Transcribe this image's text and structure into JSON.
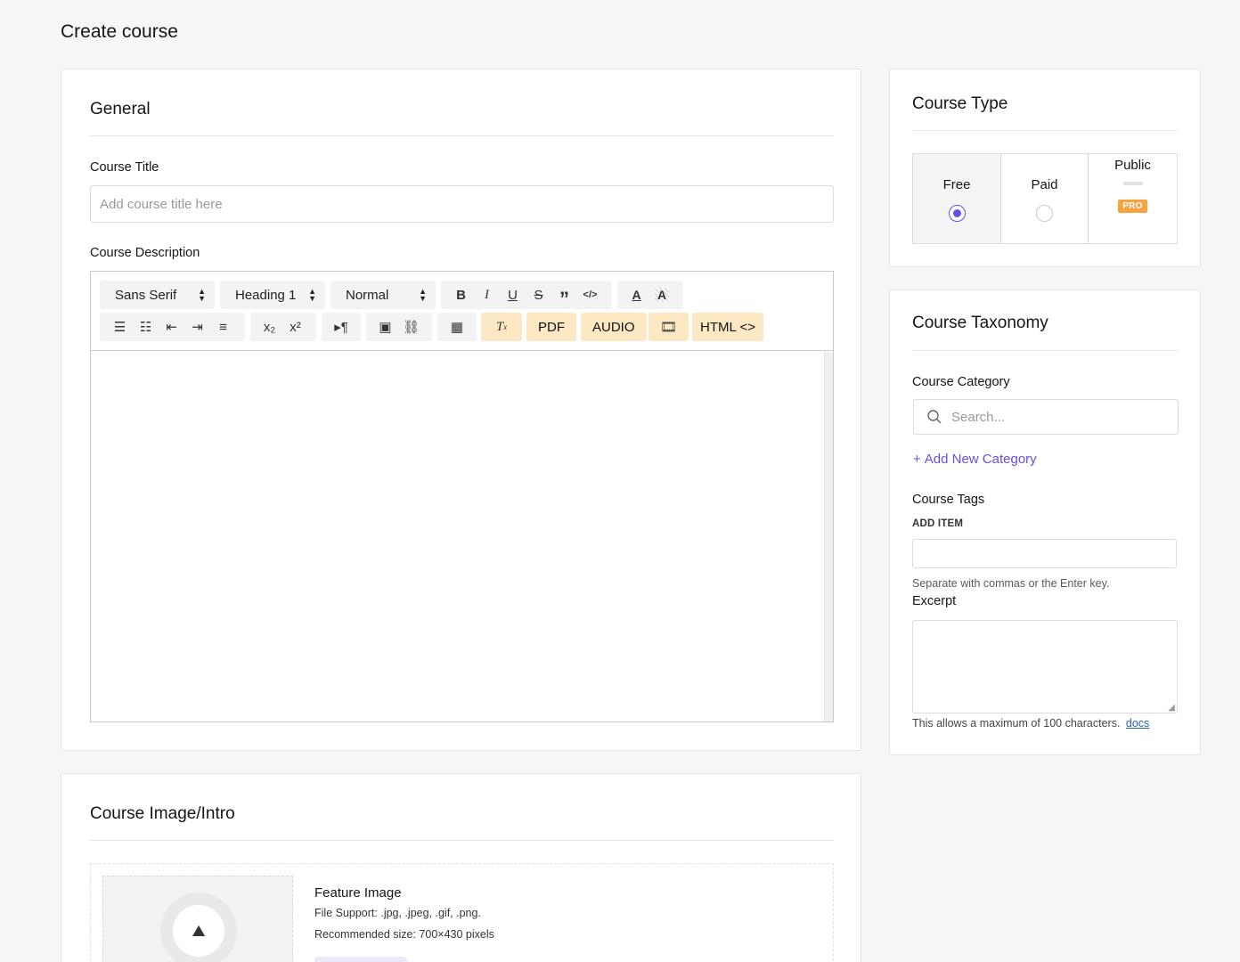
{
  "page_title": "Create course",
  "general": {
    "title": "General",
    "course_title_label": "Course Title",
    "course_title_placeholder": "Add course title here",
    "course_description_label": "Course Description",
    "toolbar": {
      "font_select": "Sans Serif",
      "heading_select": "Heading 1",
      "size_select": "Normal",
      "pdf": "PDF",
      "audio": "AUDIO",
      "html": "HTML <>"
    }
  },
  "course_type": {
    "title": "Course Type",
    "options": [
      {
        "label": "Free",
        "selected": true
      },
      {
        "label": "Paid",
        "selected": false
      },
      {
        "label": "Public",
        "badge": "PRO"
      }
    ]
  },
  "taxonomy": {
    "title": "Course Taxonomy",
    "category_label": "Course Category",
    "search_placeholder": "Search...",
    "add_category": "Add New Category",
    "tags_label": "Course Tags",
    "add_item_label": "ADD ITEM",
    "tags_help": "Separate with commas or the Enter key.",
    "excerpt_label": "Excerpt",
    "excerpt_help": "This allows a maximum of 100 characters.",
    "docs_link": "docs"
  },
  "image_intro": {
    "title": "Course Image/Intro",
    "feature_image_label": "Feature Image",
    "file_support": "File Support: .jpg, .jpeg, .gif, .png.",
    "recommended_size": "Recommended size: 700×430 pixels"
  },
  "colors": {
    "accent": "#6b4ce6",
    "pro": "#f7a440",
    "pro_bg": "#fde8c4"
  }
}
